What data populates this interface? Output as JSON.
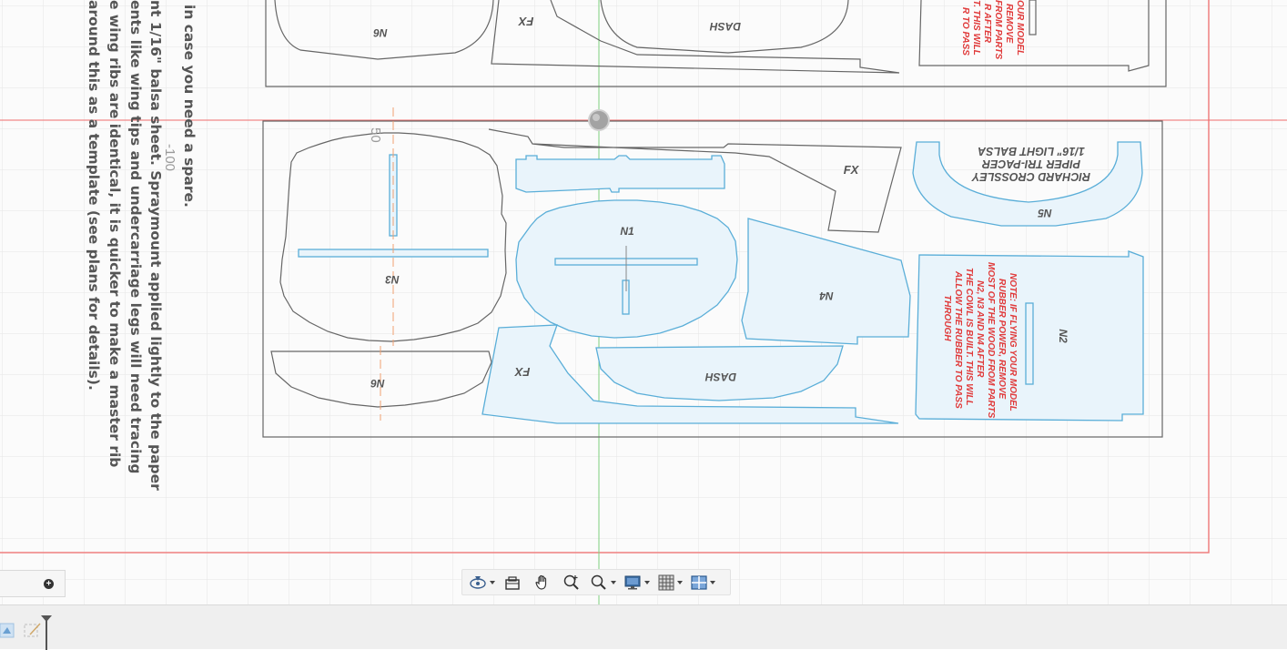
{
  "document": {
    "instructions": [
      " in case you need a spare.",
      "nt 1/16\" balsa sheet. Spraymount applied lightly to the paper",
      "ents like wing tips and undercarriage legs will need tracing",
      "e wing ribs are identical, it is quicker to make a master rib",
      "around this as a template (see plans for details)."
    ],
    "ruler_labels": [
      "-100",
      "50"
    ],
    "part_labels": {
      "n1": "N1",
      "n2": "N2",
      "n3": "N3",
      "n4": "N4",
      "n5": "N5",
      "n6": "N6",
      "fx": "FX",
      "dash": "DASH"
    },
    "sheet_title": [
      "RICHARD CROSSLEY",
      "PIPER TRI-PACER",
      "1/16\" LIGHT BALSA"
    ],
    "note_lines": [
      "NOTE: IF FLYING YOUR MODEL",
      "RUBBER POWER, REMOVE",
      "MOST OF THE WOOD FROM PARTS",
      "N2, N3 AND N4 AFTER",
      "THE COWL IS BUILT. THIS WILL",
      "ALLOW THE RUBBER TO PASS",
      "THROUGH"
    ],
    "note_top_lines": [
      "OUR MODEL",
      "REMOVE",
      "FROM PARTS",
      "R AFTER",
      "T. THIS WILL",
      "R TO PASS"
    ]
  },
  "toolbar": {
    "items": [
      {
        "name": "orbit-icon",
        "caret": true
      },
      {
        "name": "look-at-icon",
        "caret": false
      },
      {
        "name": "pan-icon",
        "caret": false
      },
      {
        "name": "zoom-icon",
        "caret": false
      },
      {
        "name": "fit-icon",
        "caret": true
      },
      {
        "name": "display-settings-icon",
        "caret": true
      },
      {
        "name": "grid-settings-icon",
        "caret": true
      },
      {
        "name": "viewports-icon",
        "caret": true
      }
    ]
  },
  "colors": {
    "canvas_bg": "#fbfbfb",
    "grid": "#e4e4e4",
    "sheet_border": "#f08080",
    "axis_red": "#ef6b6b",
    "axis_green": "#7dcf7d",
    "part_outline": "#666666",
    "selected_outline": "#5aaed8",
    "selected_fill": "#e9f4fb",
    "note_red": "#e03a3a"
  }
}
